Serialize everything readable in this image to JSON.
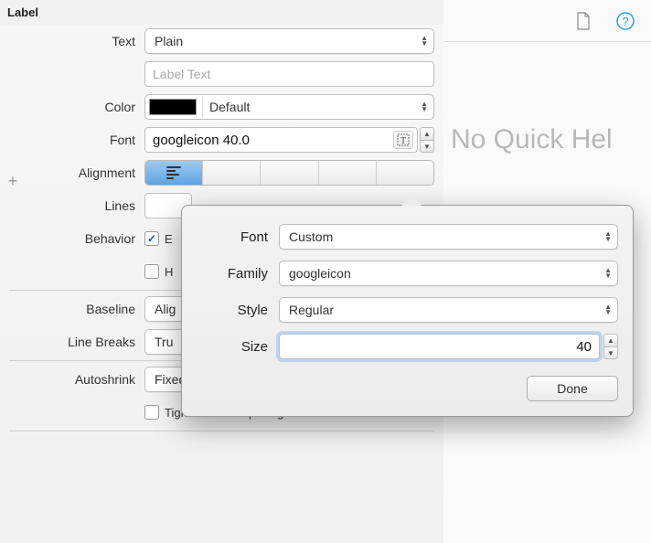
{
  "section": {
    "title": "Label"
  },
  "labels": {
    "text": "Text",
    "color": "Color",
    "font": "Font",
    "alignment": "Alignment",
    "lines": "Lines",
    "behavior": "Behavior",
    "baseline": "Baseline",
    "lineBreaks": "Line Breaks",
    "autoshrink": "Autoshrink"
  },
  "values": {
    "textStyle": "Plain",
    "labelPlaceholder": "Label Text",
    "colorName": "Default",
    "fontDisplay": "googleicon 40.0",
    "linesValue": "",
    "behaviorEnabled": "E",
    "behaviorH": "H",
    "baseline": "Alig",
    "lineBreaks": "Tru",
    "autoshrink": "Fixed Font Size",
    "tighten": "Tighten Letter Spacing"
  },
  "rightPanel": {
    "noHelp": "No Quick Hel"
  },
  "popover": {
    "labels": {
      "font": "Font",
      "family": "Family",
      "style": "Style",
      "size": "Size"
    },
    "font": "Custom",
    "family": "googleicon",
    "style": "Regular",
    "size": "40",
    "done": "Done"
  }
}
